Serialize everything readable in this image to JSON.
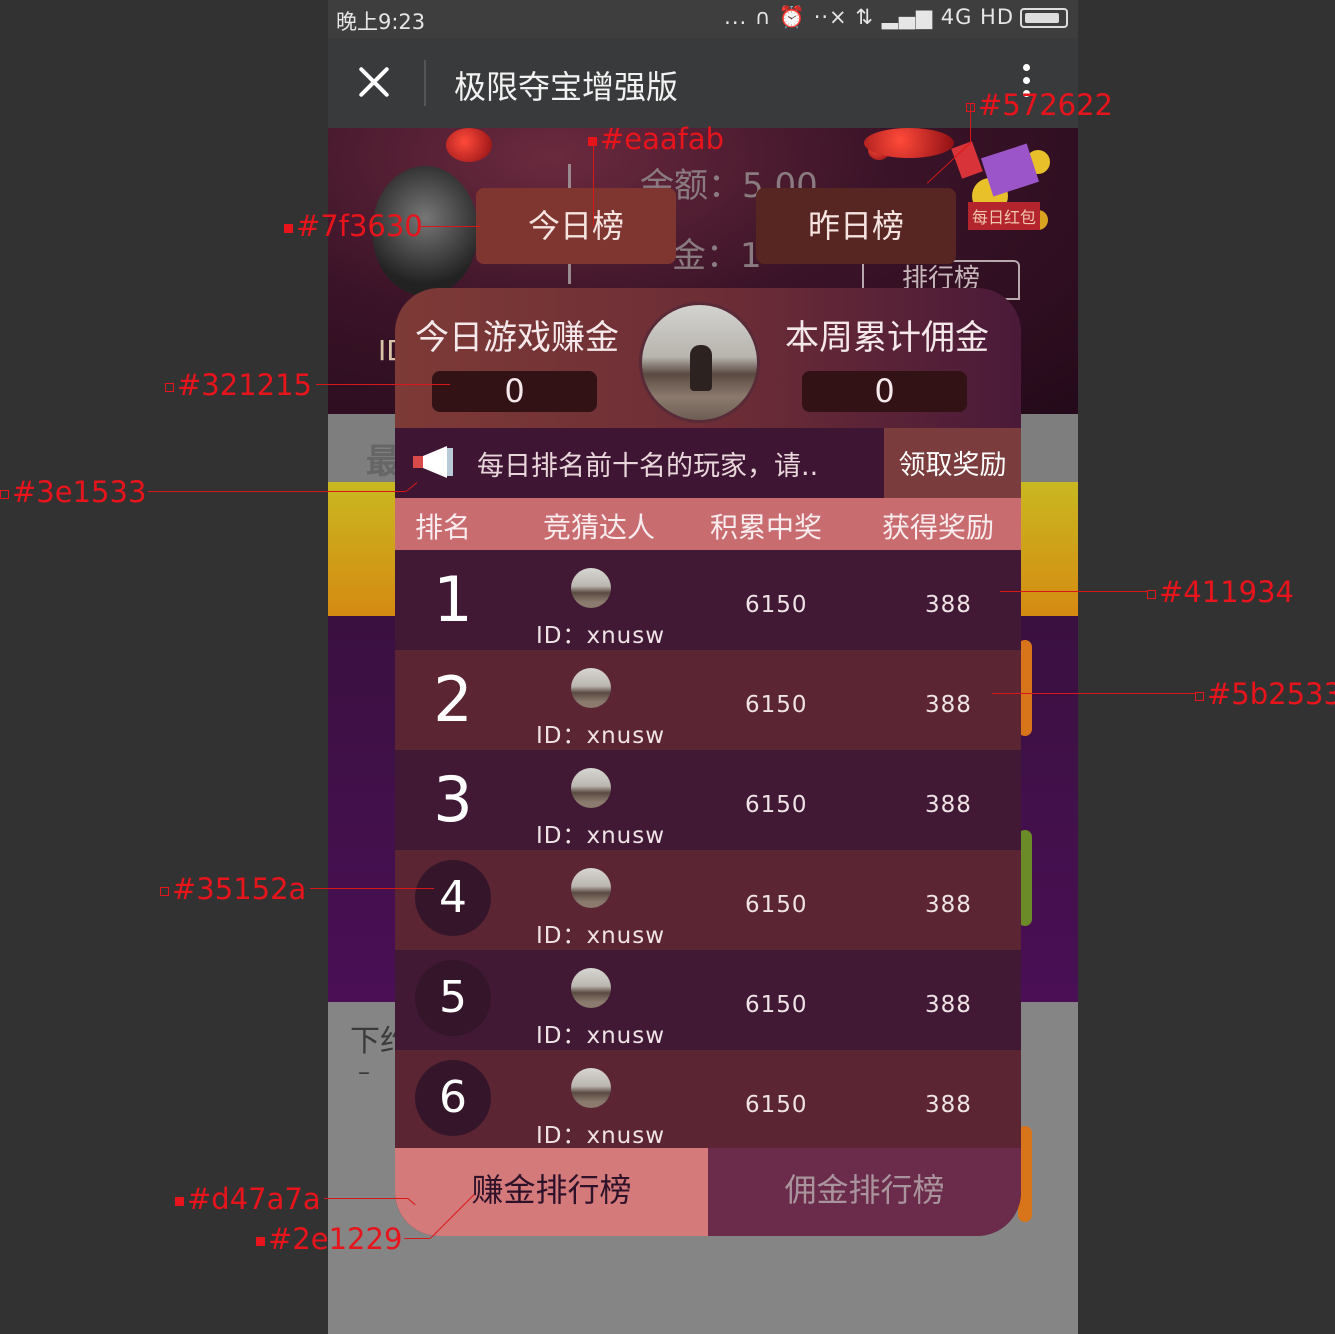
{
  "status_bar": {
    "time": "晚上9:23",
    "indicators": "... ∩ ⏰ ··× ⇅ ▂▄▆ 4G HD"
  },
  "nav": {
    "title": "极限夺宝增强版"
  },
  "background": {
    "balance_line1": "余额：5.00",
    "balance_line2": "金：1",
    "red_packet_label": "每日红包",
    "rank_link": "排行榜",
    "id_fragment": "ID",
    "left_text": "最",
    "bottom_text": "下约",
    "bottom_dash": "–"
  },
  "tabs": {
    "today": "今日榜",
    "yesterday": "昨日榜"
  },
  "panel": {
    "left_label": "今日游戏赚金",
    "left_value": "0",
    "right_label": "本周累计佣金",
    "right_value": "0",
    "notice": "每日排名前十名的玩家，请..",
    "claim_button": "领取奖励",
    "columns": [
      "排名",
      "竞猜达人",
      "积累中奖",
      "获得奖励"
    ],
    "rows": [
      {
        "rank": "1",
        "id": "ID：xnusw",
        "score": "6150",
        "reward": "388"
      },
      {
        "rank": "2",
        "id": "ID：xnusw",
        "score": "6150",
        "reward": "388"
      },
      {
        "rank": "3",
        "id": "ID：xnusw",
        "score": "6150",
        "reward": "388"
      },
      {
        "rank": "4",
        "id": "ID：xnusw",
        "score": "6150",
        "reward": "388"
      },
      {
        "rank": "5",
        "id": "ID：xnusw",
        "score": "6150",
        "reward": "388"
      },
      {
        "rank": "6",
        "id": "ID：xnusw",
        "score": "6150",
        "reward": "388"
      }
    ],
    "footer_tabs": {
      "earnings": "赚金排行榜",
      "commission": "佣金排行榜"
    }
  },
  "annotations": {
    "c572622": "#572622",
    "ceaafab": "#eaafab",
    "c7f3630": "#7f3630",
    "c321215": "#321215",
    "c3e1533": "#3e1533",
    "c411934": "#411934",
    "c5b2533": "#5b2533",
    "c35152a": "#35152a",
    "cd47a7a": "#d47a7a",
    "c2e1229": "#2e1229"
  }
}
